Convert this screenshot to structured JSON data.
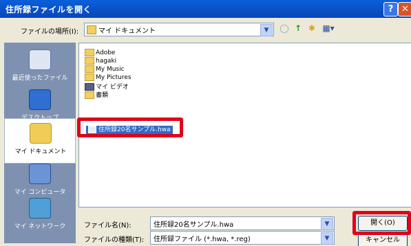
{
  "window": {
    "title": "住所録ファイルを開く",
    "help_glyph": "?",
    "close_glyph": "✕"
  },
  "location": {
    "label": "ファイルの場所(I):",
    "value": "マイ ドキュメント",
    "dropdown_glyph": "▼"
  },
  "toolbar": {
    "back_glyph": "◯",
    "up_glyph": "↑",
    "new_folder_glyph": "✱",
    "view_glyph": "▦▾"
  },
  "places": [
    {
      "label": "最近使ったファイル",
      "icon": "recent-icon"
    },
    {
      "label": "デスクトップ",
      "icon": "desktop-icon"
    },
    {
      "label": "マイ ドキュメント",
      "icon": "my-documents-icon"
    },
    {
      "label": "マイ コンピュータ",
      "icon": "my-computer-icon"
    },
    {
      "label": "マイ ネットワーク",
      "icon": "my-network-icon"
    }
  ],
  "files": [
    {
      "name": "Adobe",
      "type": "folder"
    },
    {
      "name": "hagaki",
      "type": "folder"
    },
    {
      "name": "My Music",
      "type": "folder"
    },
    {
      "name": "My Pictures",
      "type": "folder"
    },
    {
      "name": "マイ ビデオ",
      "type": "video"
    },
    {
      "name": "書類",
      "type": "folder"
    }
  ],
  "selected_file": "住所録20名サンプル.hwa",
  "filename": {
    "label": "ファイル名(N):",
    "value": "住所録20名サンプル.hwa"
  },
  "filetype": {
    "label": "ファイルの種類(T):",
    "value": "住所録ファイル (*.hwa, *.reg)"
  },
  "buttons": {
    "open": "開く(O)",
    "cancel": "キャンセル"
  },
  "colors": {
    "highlight": "#e1001a",
    "selection": "#316ac5",
    "titlebar": "#0a5fd8"
  }
}
